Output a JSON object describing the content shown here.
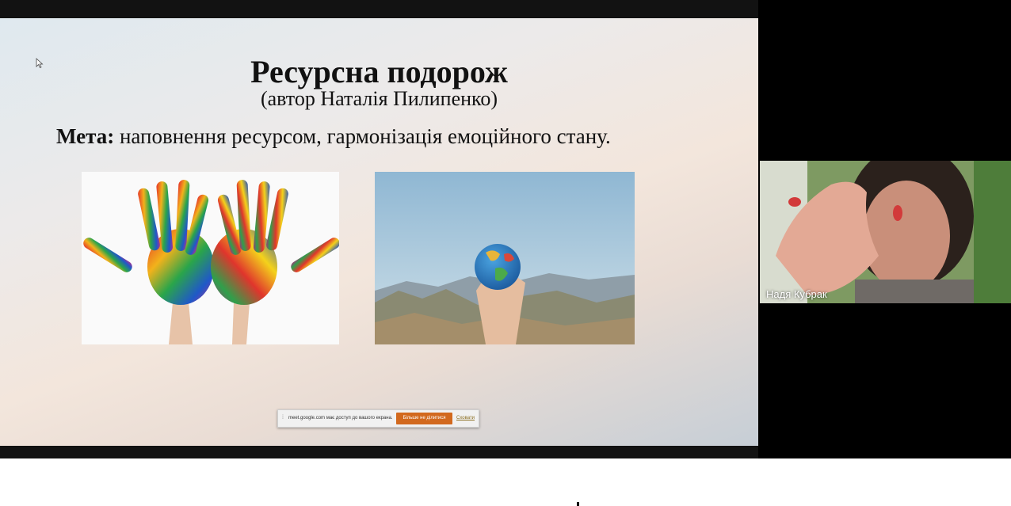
{
  "slide": {
    "title": "Ресурсна подорож",
    "subtitle": "(автор Наталія Пилипенко)",
    "goal_label": "Мета:",
    "goal_text": " наповнення ресурсом, гармонізація емоційного стану."
  },
  "share_bar": {
    "message": "meet.google.com має доступ до вашого екрана.",
    "stop_label": "Більше не ділитися",
    "hide_label": "Сховати"
  },
  "participant": {
    "name": "Надя Кубрак"
  },
  "colors": {
    "stop_button": "#d2691e",
    "video_background": "#000000"
  },
  "icons": {
    "cursor": "mouse-pointer-icon",
    "grip": "drag-handle-icon"
  }
}
